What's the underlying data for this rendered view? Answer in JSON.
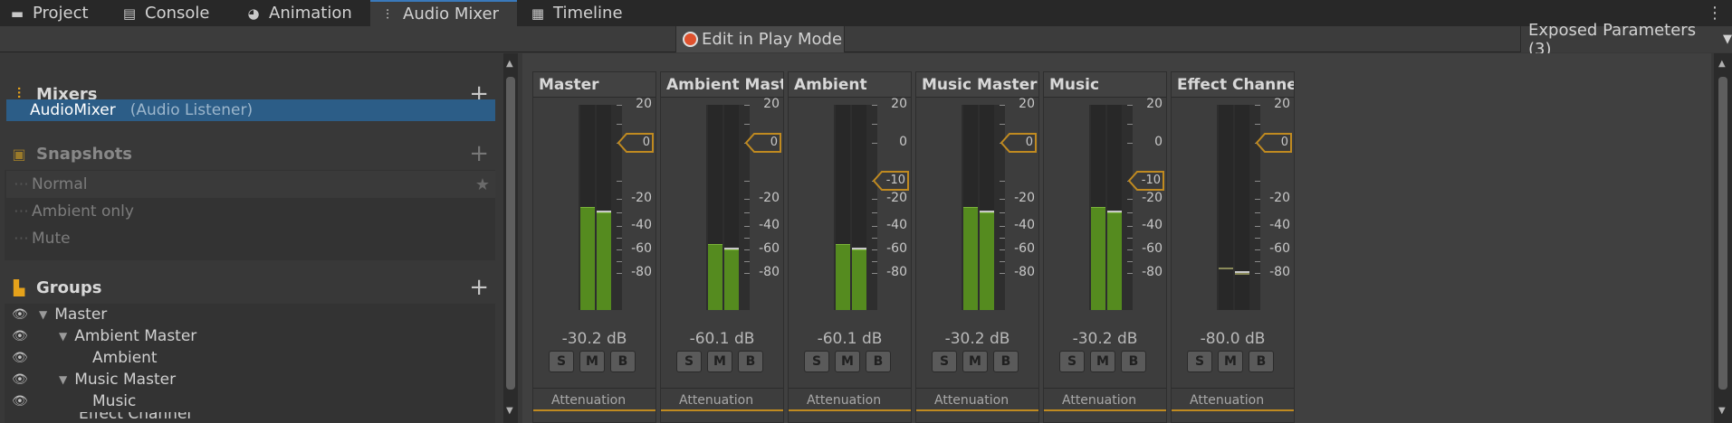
{
  "tabs": [
    {
      "label": "Project",
      "icon": "folder-icon"
    },
    {
      "label": "Console",
      "icon": "console-icon"
    },
    {
      "label": "Animation",
      "icon": "animation-icon"
    },
    {
      "label": "Audio Mixer",
      "icon": "mixer-icon",
      "active": true
    },
    {
      "label": "Timeline",
      "icon": "timeline-icon"
    }
  ],
  "toolbar": {
    "play_mode_label": "Edit in Play Mode",
    "exposed_label": "Exposed Parameters (3)"
  },
  "mixers": {
    "title": "Mixers",
    "items": [
      {
        "name": "AudioMixer",
        "sub": "(Audio Listener)"
      }
    ]
  },
  "snapshots": {
    "title": "Snapshots",
    "items": [
      "Normal",
      "Ambient only",
      "Mute"
    ]
  },
  "groups": {
    "title": "Groups",
    "items": [
      {
        "label": "Master",
        "depth": 0,
        "expander": true
      },
      {
        "label": "Ambient Master",
        "depth": 1,
        "expander": true
      },
      {
        "label": "Ambient",
        "depth": 2,
        "expander": false
      },
      {
        "label": "Music Master",
        "depth": 1,
        "expander": true
      },
      {
        "label": "Music",
        "depth": 2,
        "expander": false
      },
      {
        "label": "Effect Channel",
        "depth": 1,
        "expander": false
      }
    ]
  },
  "scale_labels": [
    "20",
    "0",
    "-20",
    "-40",
    "-60",
    "-80"
  ],
  "strips": [
    {
      "title": "Master",
      "db": "-30.2 dB",
      "fader": "0",
      "fader_db": 0,
      "level_db": -30.2,
      "peak_db": -30.2
    },
    {
      "title": "Ambient Master",
      "db": "-60.1 dB",
      "fader": "0",
      "fader_db": 0,
      "level_db": -60.1,
      "peak_db": -60.1
    },
    {
      "title": "Ambient",
      "db": "-60.1 dB",
      "fader": "-10",
      "fader_db": -10,
      "level_db": -60.1,
      "peak_db": -60.1
    },
    {
      "title": "Music Master",
      "db": "-30.2 dB",
      "fader": "0",
      "fader_db": 0,
      "level_db": -30.2,
      "peak_db": -30.2
    },
    {
      "title": "Music",
      "db": "-30.2 dB",
      "fader": "-10",
      "fader_db": -10,
      "level_db": -30.2,
      "peak_db": -30.2
    },
    {
      "title": "Effect Channel",
      "db": "-80.0 dB",
      "fader": "0",
      "fader_db": 0,
      "level_db": -80.0,
      "peak_db": -80.0
    }
  ],
  "strip_buttons": [
    "S",
    "M",
    "B"
  ],
  "effect_label": "Attenuation",
  "colors": {
    "accent": "#e5a21b",
    "meter": "#558b1f",
    "selection": "#2c5d87",
    "play": "#e0522e"
  }
}
